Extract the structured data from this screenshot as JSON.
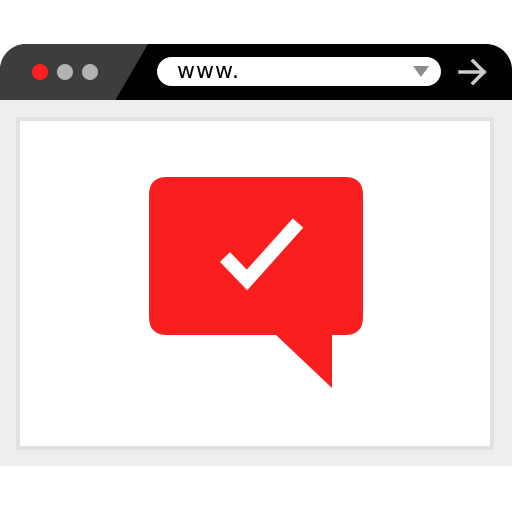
{
  "browser": {
    "url_text": "www.",
    "window_controls": [
      "close-dot",
      "minimize-dot",
      "maximize-dot"
    ],
    "icons": {
      "dropdown": "chevron-down-icon",
      "go": "arrow-right-icon",
      "message": "chat-bubble-check-icon"
    }
  },
  "colors": {
    "titlebar": "#000000",
    "titlebar_panel": "#3d3d3d",
    "close_dot": "#ff2020",
    "other_dots": "#b3b3b3",
    "dropdown": "#8c8c8c",
    "go_arrow": "#cccccc",
    "frame": "#eeeeee",
    "frame_border": "#e2e2e2",
    "bubble": "#fa1f1f",
    "check": "#ffffff"
  }
}
